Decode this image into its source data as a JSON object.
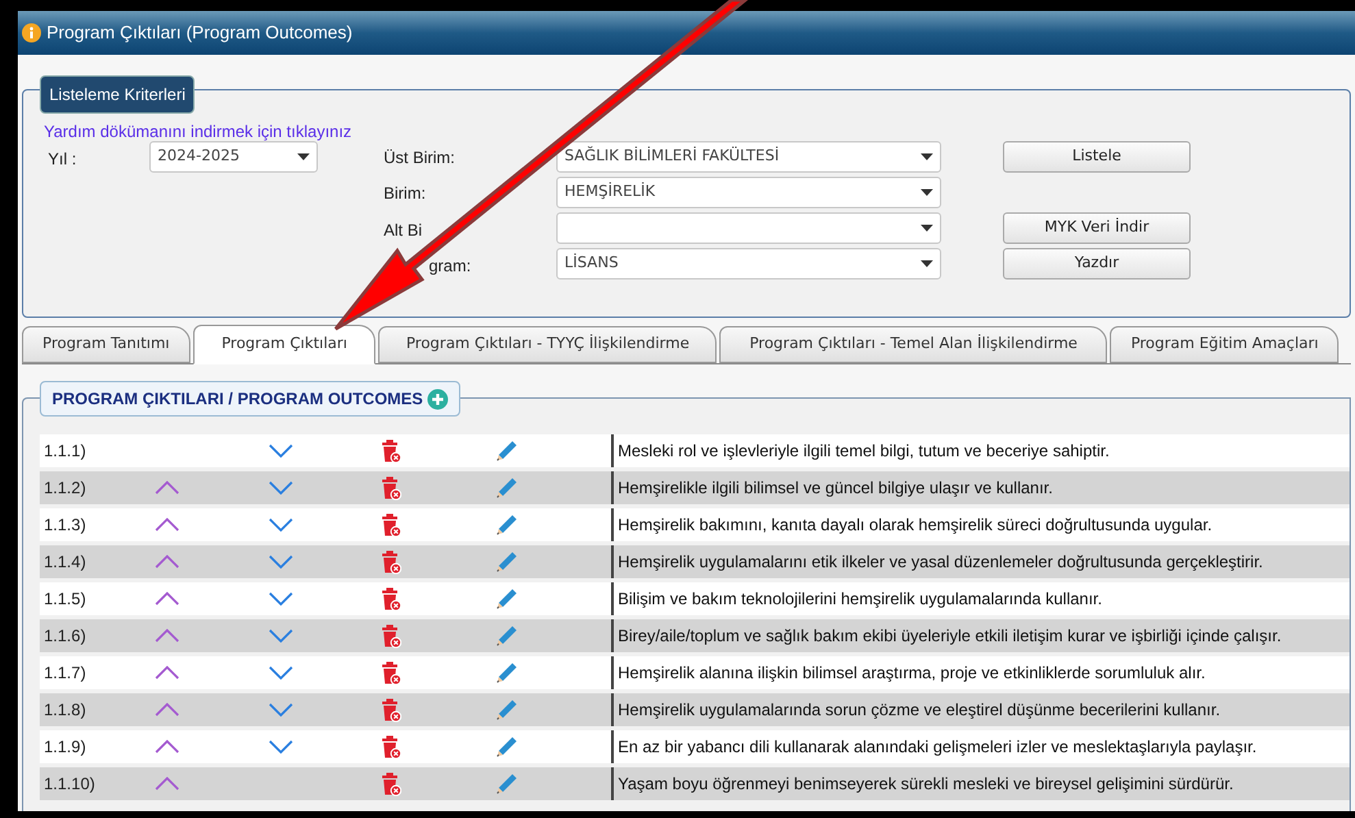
{
  "window": {
    "title": "Program Çıktıları (Program Outcomes)"
  },
  "criteria": {
    "legend": "Listeleme Kriterleri",
    "help_link": "Yardım dökümanını indirmek için tıklayınız",
    "year": {
      "label": "Yıl :",
      "value": "2024-2025"
    },
    "fields": [
      {
        "label": "Üst Birim:",
        "value": "SAĞLIK BİLİMLERİ FAKÜLTESİ"
      },
      {
        "label": "Birim:",
        "value": "HEMŞİRELİK"
      },
      {
        "label": "Alt Bi"
      },
      {
        "label": "gram:",
        "value": "LİSANS"
      }
    ],
    "buttons": [
      {
        "label": "Listele"
      },
      {
        "label": "MYK Veri İndir"
      },
      {
        "label": "Yazdır"
      }
    ]
  },
  "tabs": [
    {
      "label": "Program Tanıtımı",
      "selected": false
    },
    {
      "label": "Program Çıktıları",
      "selected": true
    },
    {
      "label": "Program Çıktıları - TYYÇ İlişkilendirme",
      "selected": false
    },
    {
      "label": "Program Çıktıları - Temel Alan İlişkilendirme",
      "selected": false
    },
    {
      "label": "Program Eğitim Amaçları",
      "selected": false
    }
  ],
  "outcomes": {
    "legend": "PROGRAM ÇIKTILARI / PROGRAM OUTCOMES",
    "rows": [
      {
        "number": "1.1.1)",
        "text": "Mesleki rol ve işlevleriyle ilgili temel bilgi, tutum ve beceriye sahiptir.",
        "can_move_up": false,
        "can_move_down": true
      },
      {
        "number": "1.1.2)",
        "text": "Hemşirelikle ilgili bilimsel ve güncel bilgiye ulaşır ve kullanır.",
        "can_move_up": true,
        "can_move_down": true
      },
      {
        "number": "1.1.3)",
        "text": "Hemşirelik bakımını, kanıta dayalı olarak hemşirelik süreci doğrultusunda uygular.",
        "can_move_up": true,
        "can_move_down": true
      },
      {
        "number": "1.1.4)",
        "text": "Hemşirelik uygulamalarını etik ilkeler ve yasal düzenlemeler doğrultusunda gerçekleştirir.",
        "can_move_up": true,
        "can_move_down": true
      },
      {
        "number": "1.1.5)",
        "text": "Bilişim ve bakım teknolojilerini hemşirelik uygulamalarında kullanır.",
        "can_move_up": true,
        "can_move_down": true
      },
      {
        "number": "1.1.6)",
        "text": "Birey/aile/toplum ve sağlık bakım ekibi üyeleriyle etkili iletişim kurar ve işbirliği içinde çalışır.",
        "can_move_up": true,
        "can_move_down": true
      },
      {
        "number": "1.1.7)",
        "text": "Hemşirelik alanına ilişkin bilimsel araştırma, proje ve etkinliklerde sorumluluk alır.",
        "can_move_up": true,
        "can_move_down": true
      },
      {
        "number": "1.1.8)",
        "text": "Hemşirelik uygulamalarında sorun çözme ve eleştirel düşünme becerilerini kullanır.",
        "can_move_up": true,
        "can_move_down": true
      },
      {
        "number": "1.1.9)",
        "text": "En az bir yabancı dili kullanarak alanındaki gelişmeleri izler ve meslektaşlarıyla paylaşır.",
        "can_move_up": true,
        "can_move_down": true
      },
      {
        "number": "1.1.10)",
        "text": "Yaşam boyu öğrenmeyi benimseyerek sürekli mesleki ve bireysel gelişimini sürdürür.",
        "can_move_up": true,
        "can_move_down": false
      }
    ]
  }
}
